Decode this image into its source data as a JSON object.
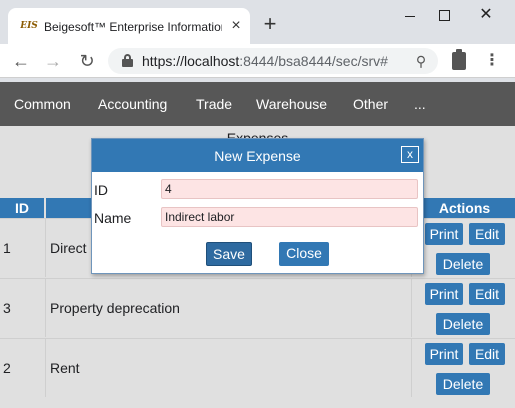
{
  "browser": {
    "tab_title": "Beigesoft™ Enterprise Information",
    "favicon_text": "EIS",
    "tab_close": "×",
    "new_tab": "+",
    "close_window": "✕",
    "url_host": "https://localhost",
    "url_rest": ":8444/bsa8444/sec/srv#"
  },
  "appnav": {
    "items": [
      "Common",
      "Accounting",
      "Trade",
      "Warehouse",
      "Other",
      "..."
    ]
  },
  "page": {
    "title": "Expenses",
    "columns": {
      "id": "ID",
      "actions": "Actions"
    },
    "rows": [
      {
        "id": "1",
        "name": "Direct"
      },
      {
        "id": "3",
        "name": "Property deprecation"
      },
      {
        "id": "2",
        "name": "Rent"
      }
    ],
    "actions": {
      "print": "Print",
      "edit": "Edit",
      "delete": "Delete"
    }
  },
  "modal": {
    "title": "New Expense",
    "close_x": "x",
    "id_label": "ID",
    "id_value": "4",
    "name_label": "Name",
    "name_value": "Indirect labor",
    "save": "Save",
    "close": "Close"
  }
}
